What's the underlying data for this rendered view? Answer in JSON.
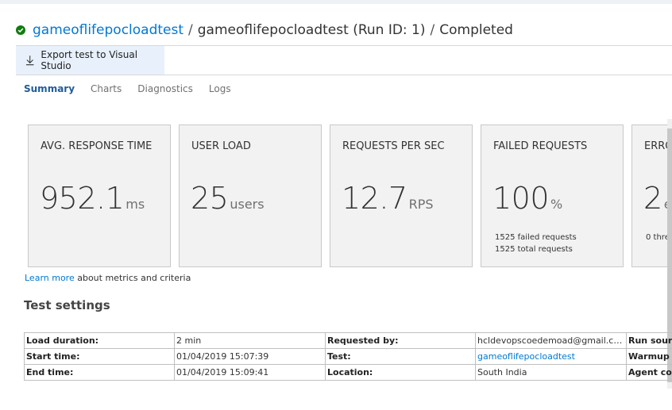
{
  "header": {
    "status": "Completed",
    "test_name_link": "gameoflifepocloadtest",
    "separator": "/",
    "run_title": "gameoflifepocloadtest (Run ID: 1)",
    "status_text": "Completed"
  },
  "toolbar": {
    "export_label": "Export test to Visual Studio"
  },
  "tabs": [
    {
      "label": "Summary",
      "active": true
    },
    {
      "label": "Charts",
      "active": false
    },
    {
      "label": "Diagnostics",
      "active": false
    },
    {
      "label": "Logs",
      "active": false
    }
  ],
  "metrics": {
    "avg_response": {
      "label": "AVG. RESPONSE TIME",
      "value": "952.1",
      "unit": "ms"
    },
    "user_load": {
      "label": "USER LOAD",
      "value": "25",
      "unit": "users"
    },
    "rps": {
      "label": "REQUESTS PER SEC",
      "value": "12.7",
      "unit": "RPS"
    },
    "failed": {
      "label": "FAILED REQUESTS",
      "value": "100",
      "unit": "%",
      "sub1": "1525 failed requests",
      "sub2": "1525 total requests"
    },
    "errors": {
      "label": "ERRO",
      "value": "2",
      "unit": "e",
      "sub1": "0 thre"
    }
  },
  "learn_more": {
    "link": "Learn more",
    "text": " about metrics and criteria"
  },
  "settings": {
    "title": "Test settings",
    "rows": [
      [
        "Load duration:",
        "2 min",
        "Requested by:",
        "hcldevopscoedemoad@gmail.co...",
        "Run sour"
      ],
      [
        "Start time:",
        "01/04/2019 15:07:39",
        "Test:",
        "gameoflifepocloadtest",
        "Warmup"
      ],
      [
        "End time:",
        "01/04/2019 15:09:41",
        "Location:",
        "South India",
        "Agent co"
      ]
    ]
  },
  "colors": {
    "accent": "#0078d4",
    "success": "#107c10",
    "card_bg": "#f2f2f2"
  }
}
